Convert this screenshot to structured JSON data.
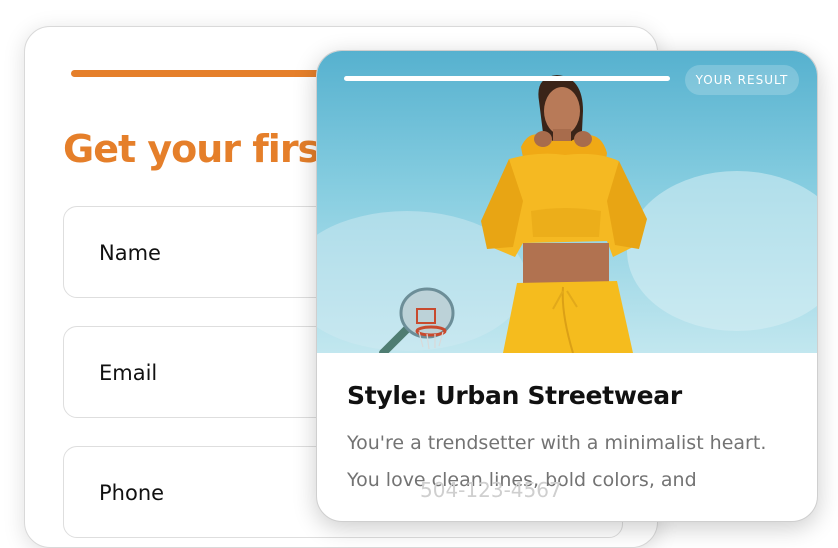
{
  "form": {
    "title": "Get your first",
    "fields": [
      {
        "label": "Name"
      },
      {
        "label": "Email"
      },
      {
        "label": "Phone"
      }
    ],
    "phone_value": "504-123-4567",
    "accent_color": "#e57f2a"
  },
  "result": {
    "badge": "YOUR RESULT",
    "title": "Style: Urban Streetwear",
    "description": "You're a trendsetter with a minimalist heart. You love clean lines, bold colors, and",
    "photo": "woman in yellow hoodie and sweatpants with basketball hoop against blue sky"
  }
}
